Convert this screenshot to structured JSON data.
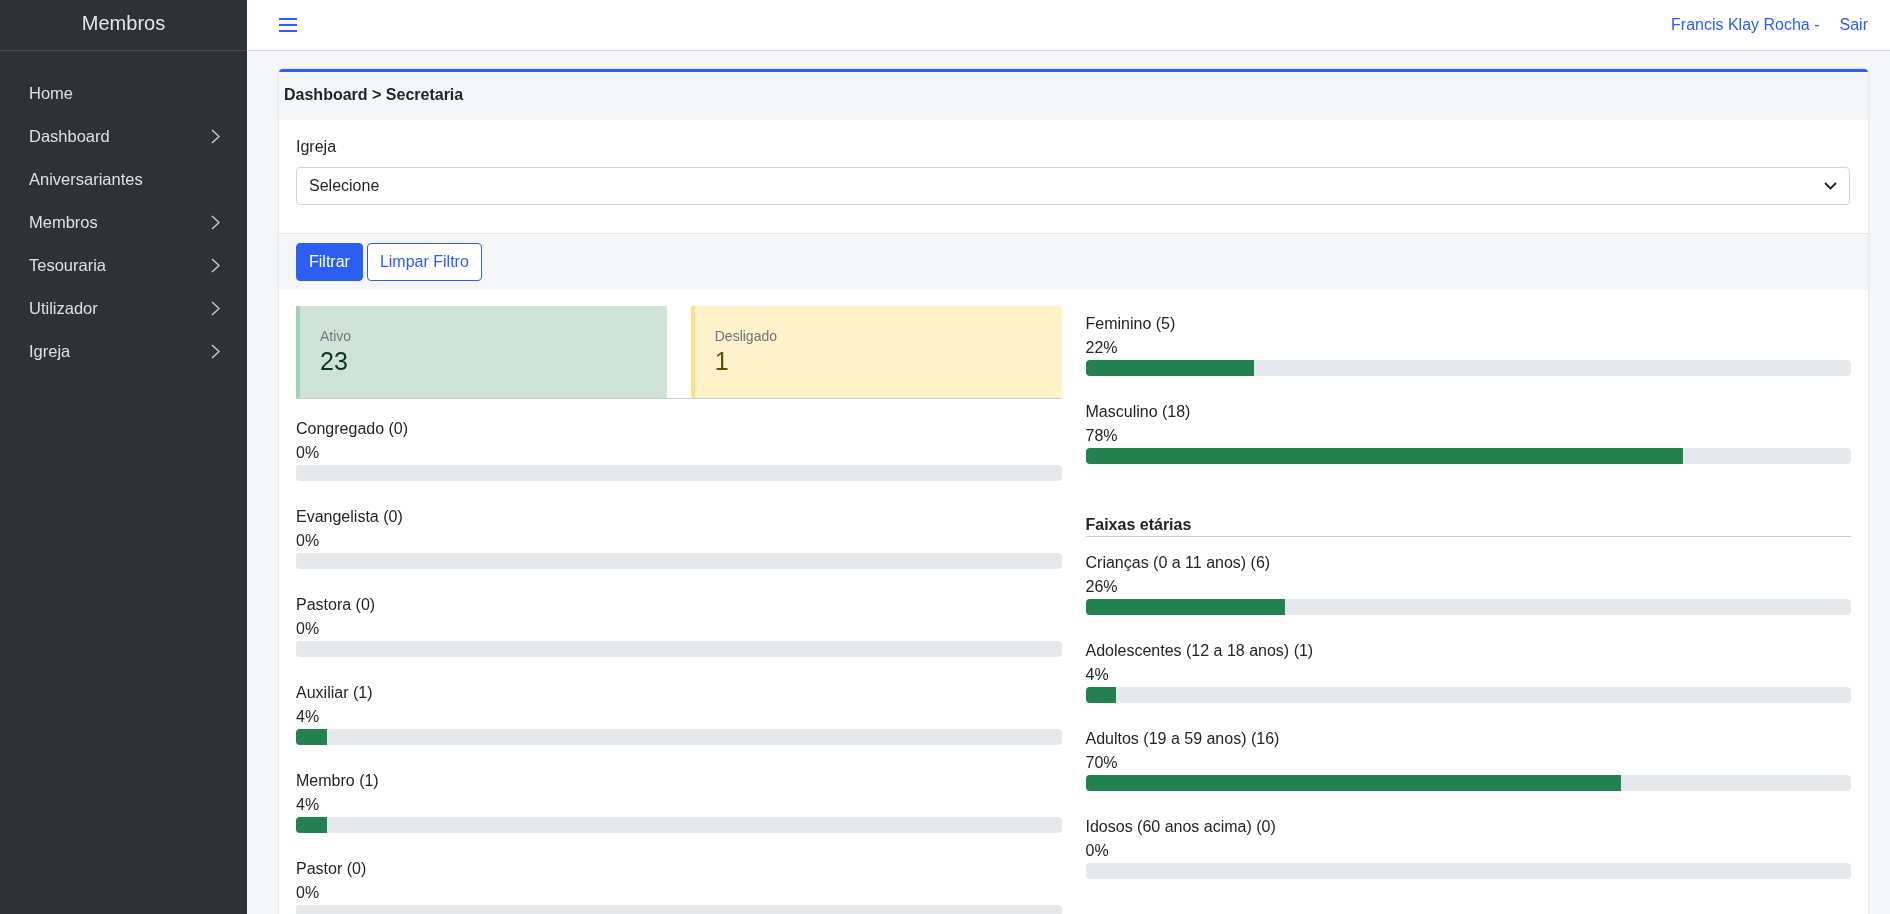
{
  "sidebar": {
    "title": "Membros",
    "items": [
      {
        "label": "Home",
        "has_submenu": false
      },
      {
        "label": "Dashboard",
        "has_submenu": true
      },
      {
        "label": "Aniversariantes",
        "has_submenu": false
      },
      {
        "label": "Membros",
        "has_submenu": true
      },
      {
        "label": "Tesouraria",
        "has_submenu": true
      },
      {
        "label": "Utilizador",
        "has_submenu": true
      },
      {
        "label": "Igreja",
        "has_submenu": true
      }
    ]
  },
  "topbar": {
    "user": "Francis Klay Rocha -",
    "logout": "Sair"
  },
  "breadcrumb": "Dashboard > Secretaria",
  "filter": {
    "label": "Igreja",
    "value": "Selecione"
  },
  "buttons": [
    {
      "label": "Filtrar",
      "kind": "primary"
    },
    {
      "label": "Limpar Filtro",
      "kind": "outline"
    }
  ],
  "status_cards": [
    {
      "label": "Ativo",
      "value": "23",
      "kind": "success"
    },
    {
      "label": "Desligado",
      "value": "1",
      "kind": "warning"
    }
  ],
  "roles": [
    {
      "label": "Congregado (0)",
      "percent": "0%",
      "level": 0
    },
    {
      "label": "Evangelista (0)",
      "percent": "0%",
      "level": 0
    },
    {
      "label": "Pastora (0)",
      "percent": "0%",
      "level": 0
    },
    {
      "label": "Auxiliar (1)",
      "percent": "4%",
      "level": 0.04
    },
    {
      "label": "Membro (1)",
      "percent": "4%",
      "level": 0.04
    },
    {
      "label": "Pastor (0)",
      "percent": "0%",
      "level": 0
    }
  ],
  "gender": [
    {
      "label": "Feminino (5)",
      "percent": "22%",
      "level": 0.22
    },
    {
      "label": "Masculino (18)",
      "percent": "78%",
      "level": 0.78
    }
  ],
  "age_groups": {
    "heading": "Faixas etárias",
    "items": [
      {
        "label": "Crianças (0 a 11 anos) (6)",
        "percent": "26%",
        "level": 0.26
      },
      {
        "label": "Adolescentes (12 a 18 anos) (1)",
        "percent": "4%",
        "level": 0.04
      },
      {
        "label": "Adultos (19 a 59 anos) (16)",
        "percent": "70%",
        "level": 0.7
      },
      {
        "label": "Idosos (60 anos acima) (0)",
        "percent": "0%",
        "level": 0
      }
    ]
  }
}
